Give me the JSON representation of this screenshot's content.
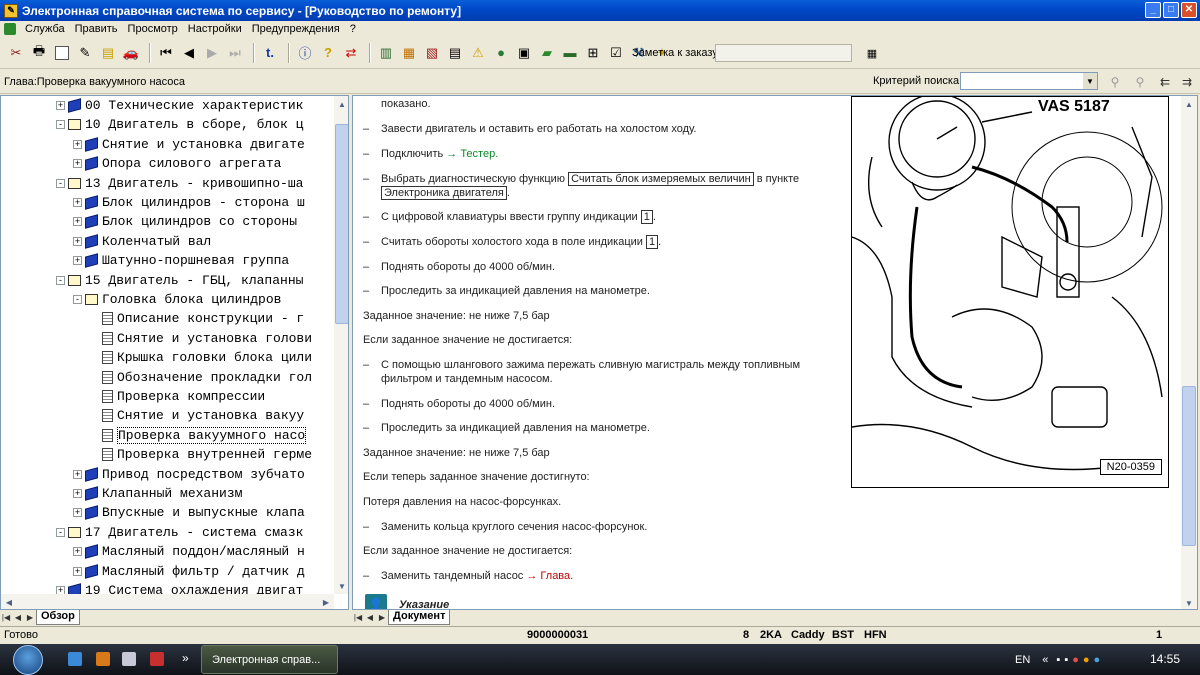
{
  "window": {
    "title": "Электронная справочная система по сервису - [Руководство по ремонту]"
  },
  "menu": [
    "Служба",
    "Править",
    "Просмотр",
    "Настройки",
    "Предупреждения",
    "?"
  ],
  "toolbar": {
    "order_note_label": "Заметка к заказу:"
  },
  "chapter_bar": {
    "chapter": "Глава:Проверка вакуумного насоса",
    "search_label": "Критерий поиска:"
  },
  "tree": [
    {
      "text": "00 Технические характеристик",
      "level": 0,
      "icon": "book-closed",
      "exp": "+"
    },
    {
      "text": "10 Двигатель в сборе, блок ц",
      "level": 0,
      "icon": "book-open",
      "exp": "-"
    },
    {
      "text": "Снятие и установка двигате",
      "level": 1,
      "icon": "book-closed",
      "exp": "+"
    },
    {
      "text": "Опора силового агрегата",
      "level": 1,
      "icon": "book-closed",
      "exp": "+"
    },
    {
      "text": "13 Двигатель - кривошипно-ша",
      "level": 0,
      "icon": "book-open",
      "exp": "-"
    },
    {
      "text": "Блок цилиндров - сторона ш",
      "level": 1,
      "icon": "book-closed",
      "exp": "+"
    },
    {
      "text": "Блок цилиндров со стороны",
      "level": 1,
      "icon": "book-closed",
      "exp": "+"
    },
    {
      "text": "Коленчатый вал",
      "level": 1,
      "icon": "book-closed",
      "exp": "+"
    },
    {
      "text": "Шатунно-поршневая группа",
      "level": 1,
      "icon": "book-closed",
      "exp": "+"
    },
    {
      "text": "15 Двигатель - ГБЦ, клапанны",
      "level": 0,
      "icon": "book-open",
      "exp": "-"
    },
    {
      "text": "Головка блока цилиндров",
      "level": 1,
      "icon": "book-open",
      "exp": "-"
    },
    {
      "text": "Описание конструкции - г",
      "level": 2,
      "icon": "page",
      "exp": ""
    },
    {
      "text": "Снятие и установка голови",
      "level": 2,
      "icon": "page",
      "exp": ""
    },
    {
      "text": "Крышка головки блока цили",
      "level": 2,
      "icon": "page",
      "exp": ""
    },
    {
      "text": "Обозначение прокладки гол",
      "level": 2,
      "icon": "page",
      "exp": ""
    },
    {
      "text": "Проверка компрессии",
      "level": 2,
      "icon": "page",
      "exp": ""
    },
    {
      "text": "Снятие и установка вакуу",
      "level": 2,
      "icon": "page",
      "exp": ""
    },
    {
      "text": "Проверка вакуумного насо",
      "level": 2,
      "icon": "page",
      "exp": ""
    },
    {
      "text": "Проверка внутренней герме",
      "level": 2,
      "icon": "page",
      "exp": ""
    },
    {
      "text": "Привод посредством зубчато",
      "level": 1,
      "icon": "book-closed",
      "exp": "+"
    },
    {
      "text": "Клапанный механизм",
      "level": 1,
      "icon": "book-closed",
      "exp": "+"
    },
    {
      "text": "Впускные и выпускные клапа",
      "level": 1,
      "icon": "book-closed",
      "exp": "+"
    },
    {
      "text": "17 Двигатель - система смазк",
      "level": 0,
      "icon": "book-open",
      "exp": "-"
    },
    {
      "text": "Масляный поддон/масляный н",
      "level": 1,
      "icon": "book-closed",
      "exp": "+"
    },
    {
      "text": "Масляный фильтр / датчик д",
      "level": 1,
      "icon": "book-closed",
      "exp": "+"
    },
    {
      "text": "19 Система охлаждения двигат",
      "level": 0,
      "icon": "book-closed",
      "exp": "+"
    }
  ],
  "left_tab": "Обзор",
  "right_tab": "Документ",
  "doc": {
    "l0": "показано.",
    "l1": "Завести двигатель и оставить его работать на холостом ходу.",
    "l2a": "Подключить ",
    "l2b": "→ Тестер.",
    "l3a": "Выбрать диагностическую функцию ",
    "l3box": "Считать блок измеряемых величин",
    "l3c": " в пункте",
    "l3box2": "Электроника двигателя",
    "l3d": ".",
    "l4a": "С цифровой клавиатуры ввести группу индикации ",
    "l4box": "1",
    "l4c": ".",
    "l5a": "Считать обороты холостого хода в поле индикации ",
    "l5box": "1",
    "l5c": ".",
    "l6": "Поднять обороты до 4000 об/мин.",
    "l7": "Проследить за индикацией давления на манометре.",
    "l8": "Заданное значение: не ниже 7,5 бар",
    "l9": "Если заданное значение не достигается:",
    "l10a": "С помощью шлангового зажима пережать сливную магистраль между топливным",
    "l10b": "фильтром и тандемным насосом.",
    "l11": "Поднять обороты до 4000 об/мин.",
    "l12": "Проследить за индикацией давления на манометре.",
    "l13": "Заданное значение: не ниже 7,5 бар",
    "l14": "Если теперь заданное значение достигнуто:",
    "l15": "Потеря давления на насос-форсунках.",
    "l16": "Заменить кольца круглого сечения насос-форсунок.",
    "l17": "Если заданное значение не достигается:",
    "l18a": "Заменить тандемный насос ",
    "l18b": "→ Глава.",
    "dash": "–",
    "note": "Указание",
    "fig_label": "VAS 5187",
    "fig_id": "N20-0359"
  },
  "status": {
    "left": "Готово",
    "code": "9000000031",
    "c1": "8",
    "c2": "2KA",
    "c3": "Caddy",
    "c4": "BST",
    "c5": "HFN",
    "c6": "1"
  },
  "taskbar": {
    "task": "Электронная справ...",
    "lang": "EN",
    "time": "14:55"
  },
  "colors": {
    "link_green": "#0a8a2a",
    "link_red": "#c00000",
    "titlebar": "#0049c8"
  }
}
